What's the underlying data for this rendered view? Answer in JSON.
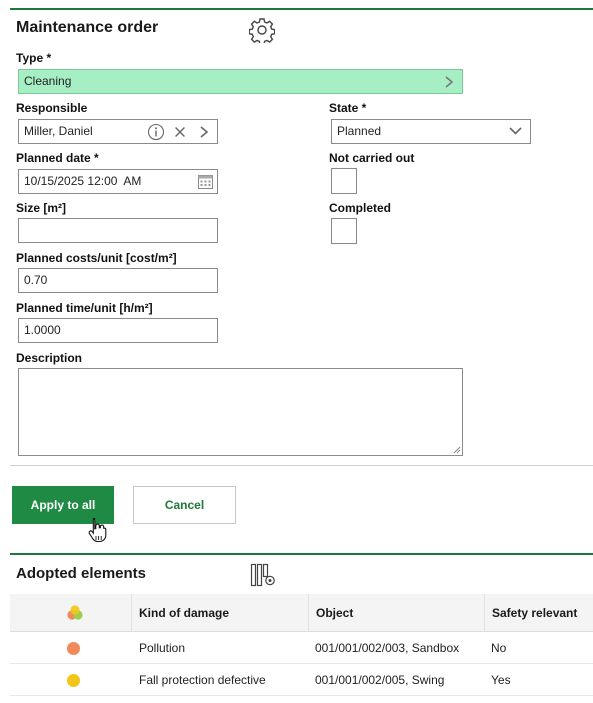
{
  "form": {
    "title": "Maintenance order",
    "type": {
      "label": "Type *",
      "value": "Cleaning"
    },
    "responsible": {
      "label": "Responsible",
      "value": "Miller, Daniel"
    },
    "state": {
      "label": "State *",
      "value": "Planned"
    },
    "planned_date": {
      "label": "Planned date *",
      "value": "10/15/2025 12:00  AM"
    },
    "not_carried_out": {
      "label": "Not carried out",
      "checked": false
    },
    "size": {
      "label": "Size [m²]",
      "value": ""
    },
    "completed": {
      "label": "Completed",
      "checked": false
    },
    "planned_costs": {
      "label": "Planned costs/unit [cost/m²]",
      "value": "0.70"
    },
    "planned_time": {
      "label": "Planned time/unit [h/m²]",
      "value": "1.0000"
    },
    "description": {
      "label": "Description",
      "value": ""
    }
  },
  "actions": {
    "apply_label": "Apply to all",
    "cancel_label": "Cancel"
  },
  "adopted": {
    "title": "Adopted elements",
    "columns": [
      "Kind of damage",
      "Object",
      "Safety relevant"
    ],
    "rows": [
      {
        "color": "#f08a5d",
        "kind": "Pollution",
        "object": "001/001/002/003, Sandbox",
        "safety": "No"
      },
      {
        "color": "#f2c618",
        "kind": "Fall protection defective",
        "object": "001/001/002/005, Swing",
        "safety": "Yes"
      }
    ]
  },
  "colors": {
    "accent": "#1e7a3c",
    "button": "#1e8a43",
    "type_field_bg": "#a6eec3"
  },
  "icons": [
    "gear-icon",
    "chevron-right-icon",
    "info-icon",
    "clear-icon",
    "chevron-down-icon",
    "calendar-icon",
    "column-settings-icon",
    "status-dots-icon",
    "hand-cursor-icon"
  ]
}
